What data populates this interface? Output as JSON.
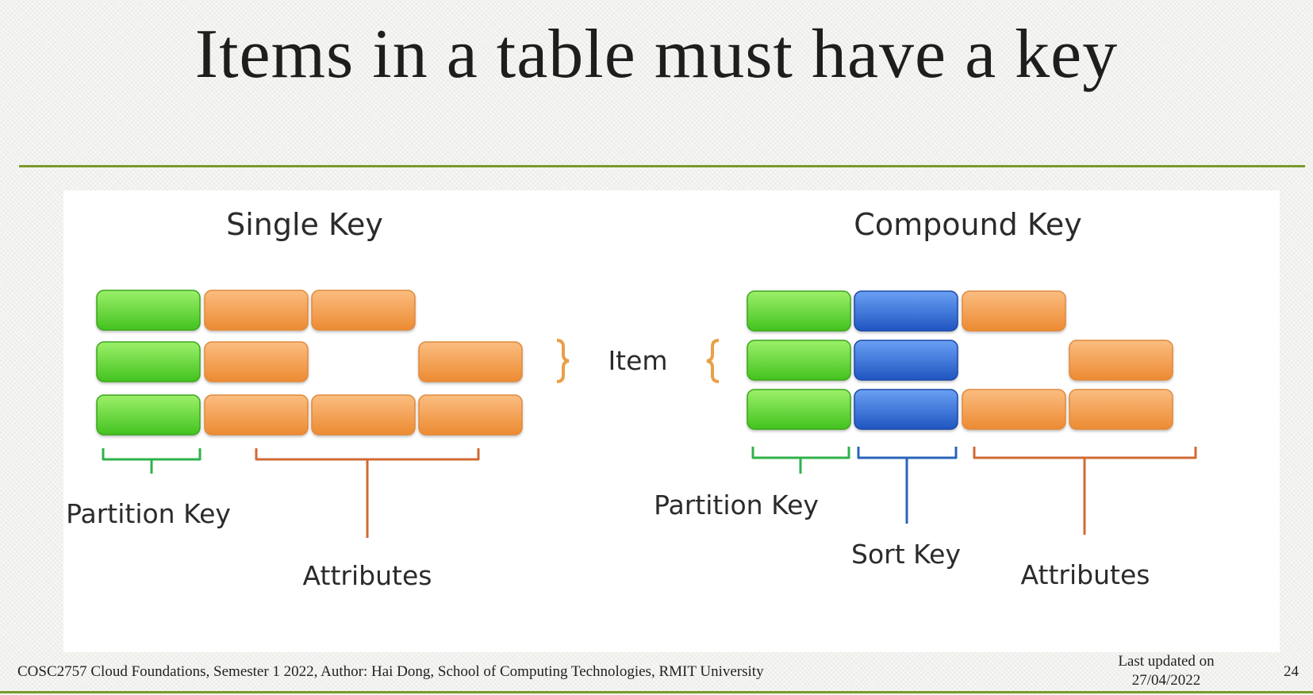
{
  "slide": {
    "title": "Items in a table must have a key",
    "footer": "COSC2757 Cloud Foundations, Semester 1 2022, Author: Hai Dong, School of Computing Technologies, RMIT University",
    "last_updated_label": "Last updated on",
    "last_updated_date": "27/04/2022",
    "page_number": "24"
  },
  "diagram": {
    "single_key": {
      "heading": "Single Key",
      "partition_label": "Partition Key",
      "attributes_label": "Attributes"
    },
    "item_label": "Item",
    "compound_key": {
      "heading": "Compound Key",
      "partition_label": "Partition Key",
      "sort_label": "Sort Key",
      "attributes_label": "Attributes"
    }
  },
  "colors": {
    "partition_key": "#5fd635",
    "sort_key": "#2f6fd8",
    "attribute": "#f39a45",
    "partition_brace": "#2fb24a",
    "sort_brace": "#2a64b8",
    "attribute_brace": "#cf6a34",
    "item_brace": "#e8a04a",
    "accent_rule": "#7a9a2c"
  }
}
